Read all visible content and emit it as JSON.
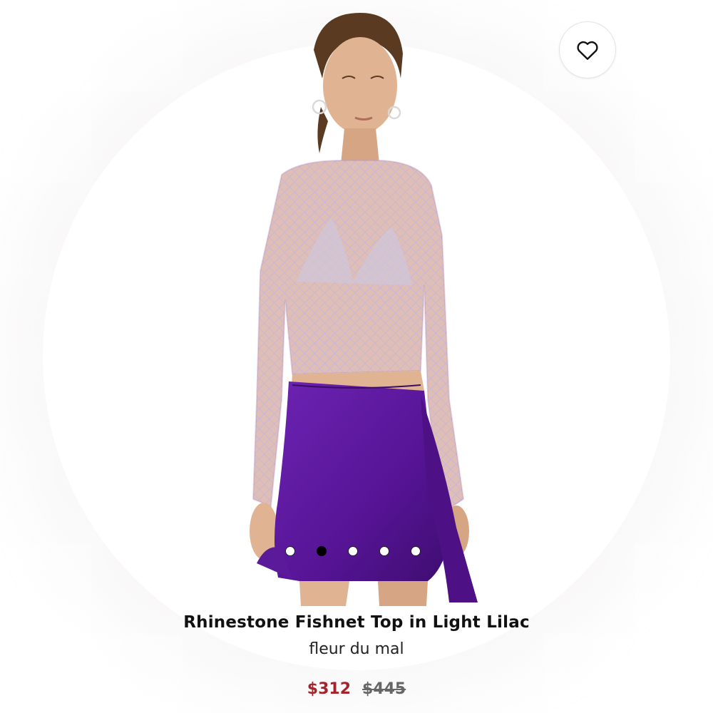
{
  "product": {
    "title": "Rhinestone Fishnet Top in Light Lilac",
    "brand": "fleur du mal",
    "price_sale": "$312",
    "price_original": "$445"
  },
  "carousel": {
    "slide_count": 5,
    "active_index": 1
  },
  "icons": {
    "wishlist": "heart-outline-icon"
  },
  "colors": {
    "sale_price": "#a5232a",
    "top": "#c9b8e6",
    "skirt": "#5a1a9a",
    "skin": "#e0b393"
  }
}
